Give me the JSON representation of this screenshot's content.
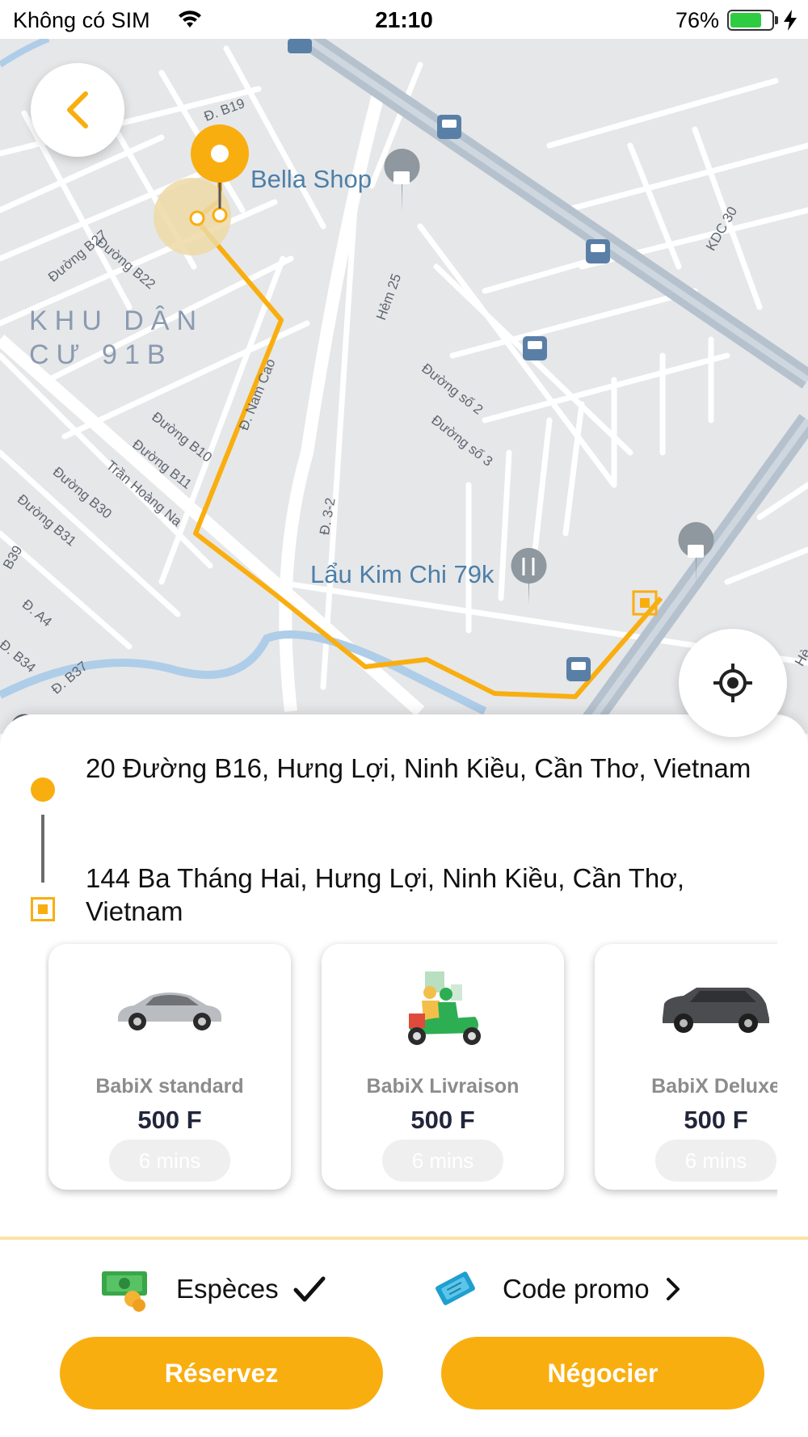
{
  "status_bar": {
    "carrier": "Không có SIM",
    "time": "21:10",
    "battery_percent": "76%",
    "battery_level": 0.76,
    "battery_color": "#2ecc40"
  },
  "map": {
    "area_label_line1": "KHU DÂN",
    "area_label_line2": "CƯ 91B",
    "pois": [
      "Bella Shop",
      "Lẩu Kim Chi 79k"
    ],
    "streets": [
      "Đ. B19",
      "Đường B27",
      "Đường B22",
      "Đ. Nam Cao",
      "Hẻm 25",
      "Đường số 2",
      "Đường số 3",
      "KDC 30",
      "Đường B10",
      "Đường B11",
      "Trần Hoàng Na",
      "Đường B30",
      "Đường B31",
      "Đ. 3-2",
      "Đ. A4",
      "Đ. B34",
      "Đ. B37",
      "B39",
      "Hè"
    ],
    "route_color": "#f9ae10",
    "icons": [
      "bus-stop-icon",
      "shopping-icon",
      "restaurant-icon",
      "origin-pin-icon",
      "destination-square-icon"
    ]
  },
  "buttons": {
    "back_icon": "chevron-left-icon",
    "locate_icon": "crosshair-icon"
  },
  "route": {
    "origin": "20 Đường B16, Hưng Lợi, Ninh Kiều, Cần Thơ, Vietnam",
    "destination": "144 Ba Tháng Hai, Hưng Lợi, Ninh Kiều, Cần Thơ, Vietnam"
  },
  "vehicles": [
    {
      "name": "BabiX standard",
      "price": "500 F",
      "eta": "6 mins",
      "icon": "car-silver-icon"
    },
    {
      "name": "BabiX Livraison",
      "price": "500 F",
      "eta": "6 mins",
      "icon": "scooter-delivery-icon"
    },
    {
      "name": "BabiX Deluxe",
      "price": "500 F",
      "eta": "6 mins",
      "icon": "suv-dark-icon"
    }
  ],
  "payment": {
    "cash_label": "Espèces",
    "cash_icon": "cash-icon",
    "promo_label": "Code promo",
    "promo_icon": "ticket-icon"
  },
  "actions": {
    "reserve_label": "Réservez",
    "negotiate_label": "Négocier",
    "accent_color": "#f9ae10"
  }
}
